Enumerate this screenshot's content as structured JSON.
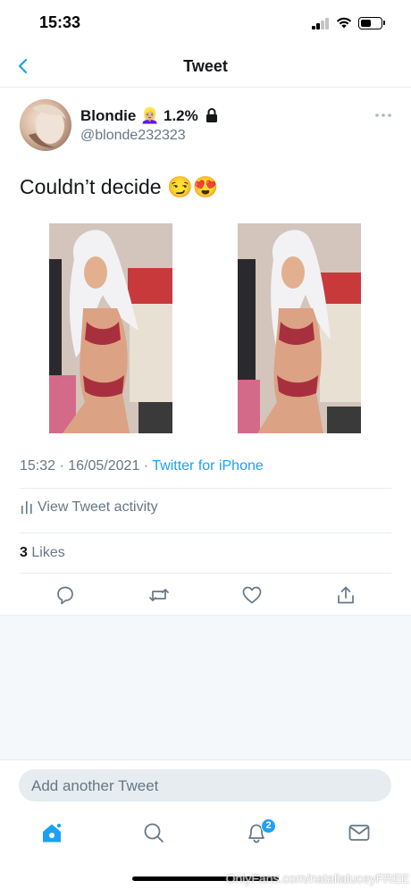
{
  "status_bar": {
    "time": "15:33"
  },
  "nav": {
    "title": "Tweet",
    "back_icon": "chevron-left-icon"
  },
  "tweet": {
    "display_name": "Blondie",
    "name_emoji": "👱🏼‍♀️",
    "name_suffix": "1.2%",
    "handle": "@blonde232323",
    "text": "Couldn’t decide 😏😍",
    "timestamp": "15:32 · 16/05/2021 · ",
    "source": "Twitter for iPhone",
    "activity_label": "View Tweet activity",
    "likes_count": "3",
    "likes_label": "Likes"
  },
  "compose": {
    "placeholder": "Add another Tweet"
  },
  "tab_bar": {
    "tabs": [
      "home-icon",
      "search-icon",
      "notifications-icon",
      "messages-icon"
    ],
    "notification_badge": "2"
  },
  "watermark": "OnlyFans.com/natalialuceyFREE",
  "colors": {
    "accent": "#1da1f2",
    "secondary_text": "#657786",
    "divider": "#e6ecf0",
    "background_gray": "#f5f8fa"
  }
}
